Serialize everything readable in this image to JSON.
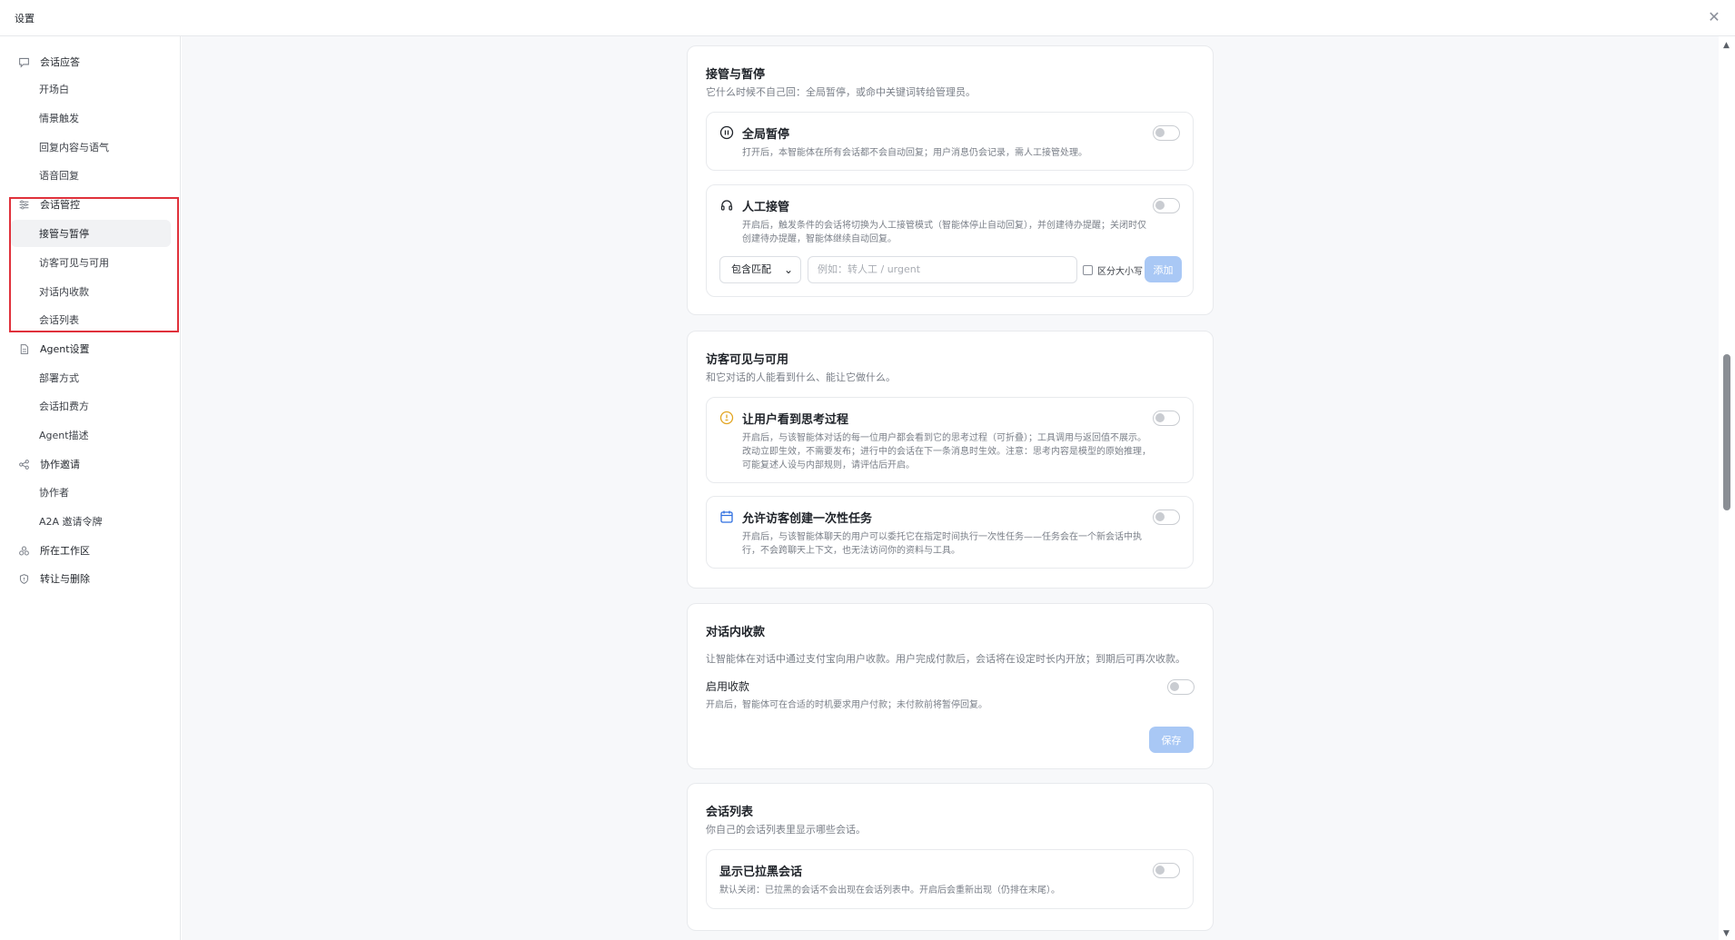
{
  "window": {
    "title": "设置",
    "close_icon": "close-icon"
  },
  "sidebar": {
    "groups": [
      {
        "label": "会话应答",
        "icon": "chat-bubble-icon",
        "items": [
          "开场白",
          "情景触发",
          "回复内容与语气",
          "语音回复"
        ]
      },
      {
        "label": "会话管控",
        "icon": "sliders-icon",
        "items": [
          "接管与暂停",
          "访客可见与可用",
          "对话内收款",
          "会话列表"
        ]
      },
      {
        "label": "Agent设置",
        "icon": "document-icon",
        "items": [
          "部署方式",
          "会话扣费方",
          "Agent描述"
        ]
      },
      {
        "label": "协作邀请",
        "icon": "share-icon",
        "items": [
          "协作者",
          "A2A 邀请令牌"
        ]
      },
      {
        "label": "所在工作区",
        "icon": "workspace-icon",
        "items": []
      },
      {
        "label": "转让与删除",
        "icon": "shield-icon",
        "items": []
      }
    ],
    "active_item": "接管与暂停",
    "highlight_color": "#e0313b"
  },
  "sections": {
    "takeover": {
      "title": "接管与暂停",
      "subtitle": "它什么时候不自己回：全局暂停，或命中关键词转给管理员。",
      "global_pause": {
        "title": "全局暂停",
        "icon": "pause-circle-icon",
        "desc": "打开后，本智能体在所有会话都不会自动回复；用户消息仍会记录，需人工接管处理。",
        "enabled": false
      },
      "manual": {
        "title": "人工接管",
        "icon": "headset-icon",
        "desc": "开启后，触发条件的会话将切换为人工接管模式（智能体停止自动回复），并创建待办提醒；关闭时仅创建待办提醒，智能体继续自动回复。",
        "enabled": false,
        "match_select": "包含匹配",
        "keyword_placeholder": "例如：转人工 / urgent",
        "case_label": "区分大小写",
        "add_label": "添加"
      }
    },
    "visitor": {
      "title": "访客可见与可用",
      "subtitle": "和它对话的人能看到什么、能让它做什么。",
      "thinking": {
        "title": "让用户看到思考过程",
        "icon": "lightbulb-icon",
        "desc": "开启后，与该智能体对话的每一位用户都会看到它的思考过程（可折叠）；工具调用与返回值不展示。改动立即生效，不需要发布；进行中的会话在下一条消息时生效。注意：思考内容是模型的原始推理，可能复述人设与内部规则，请评估后开启。",
        "enabled": false
      },
      "task": {
        "title": "允许访客创建一次性任务",
        "icon": "calendar-icon",
        "desc": "开启后，与该智能体聊天的用户可以委托它在指定时间执行一次性任务——任务会在一个新会话中执行，不会跨聊天上下文，也无法访问你的资料与工具。",
        "enabled": false
      }
    },
    "payment": {
      "title": "对话内收款",
      "subtitle": "让智能体在对话中通过支付宝向用户收款。用户完成付款后，会话将在设定时长内开放；到期后可再次收款。",
      "enable_label": "启用收款",
      "enable_desc": "开启后，智能体可在合适的时机要求用户付款；未付款前将暂停回复。",
      "enabled": false,
      "save_label": "保存"
    },
    "session_list": {
      "title": "会话列表",
      "subtitle": "你自己的会话列表里显示哪些会话。",
      "blocked": {
        "title": "显示已拉黑会话",
        "desc": "默认关闭：已拉黑的会话不会出现在会话列表中。开启后会重新出现（仍排在末尾）。",
        "enabled": false
      }
    }
  },
  "colors": {
    "primary_disabled": "#a9c8f5",
    "border": "#e8eaed",
    "muted_text": "#7a7f88"
  }
}
